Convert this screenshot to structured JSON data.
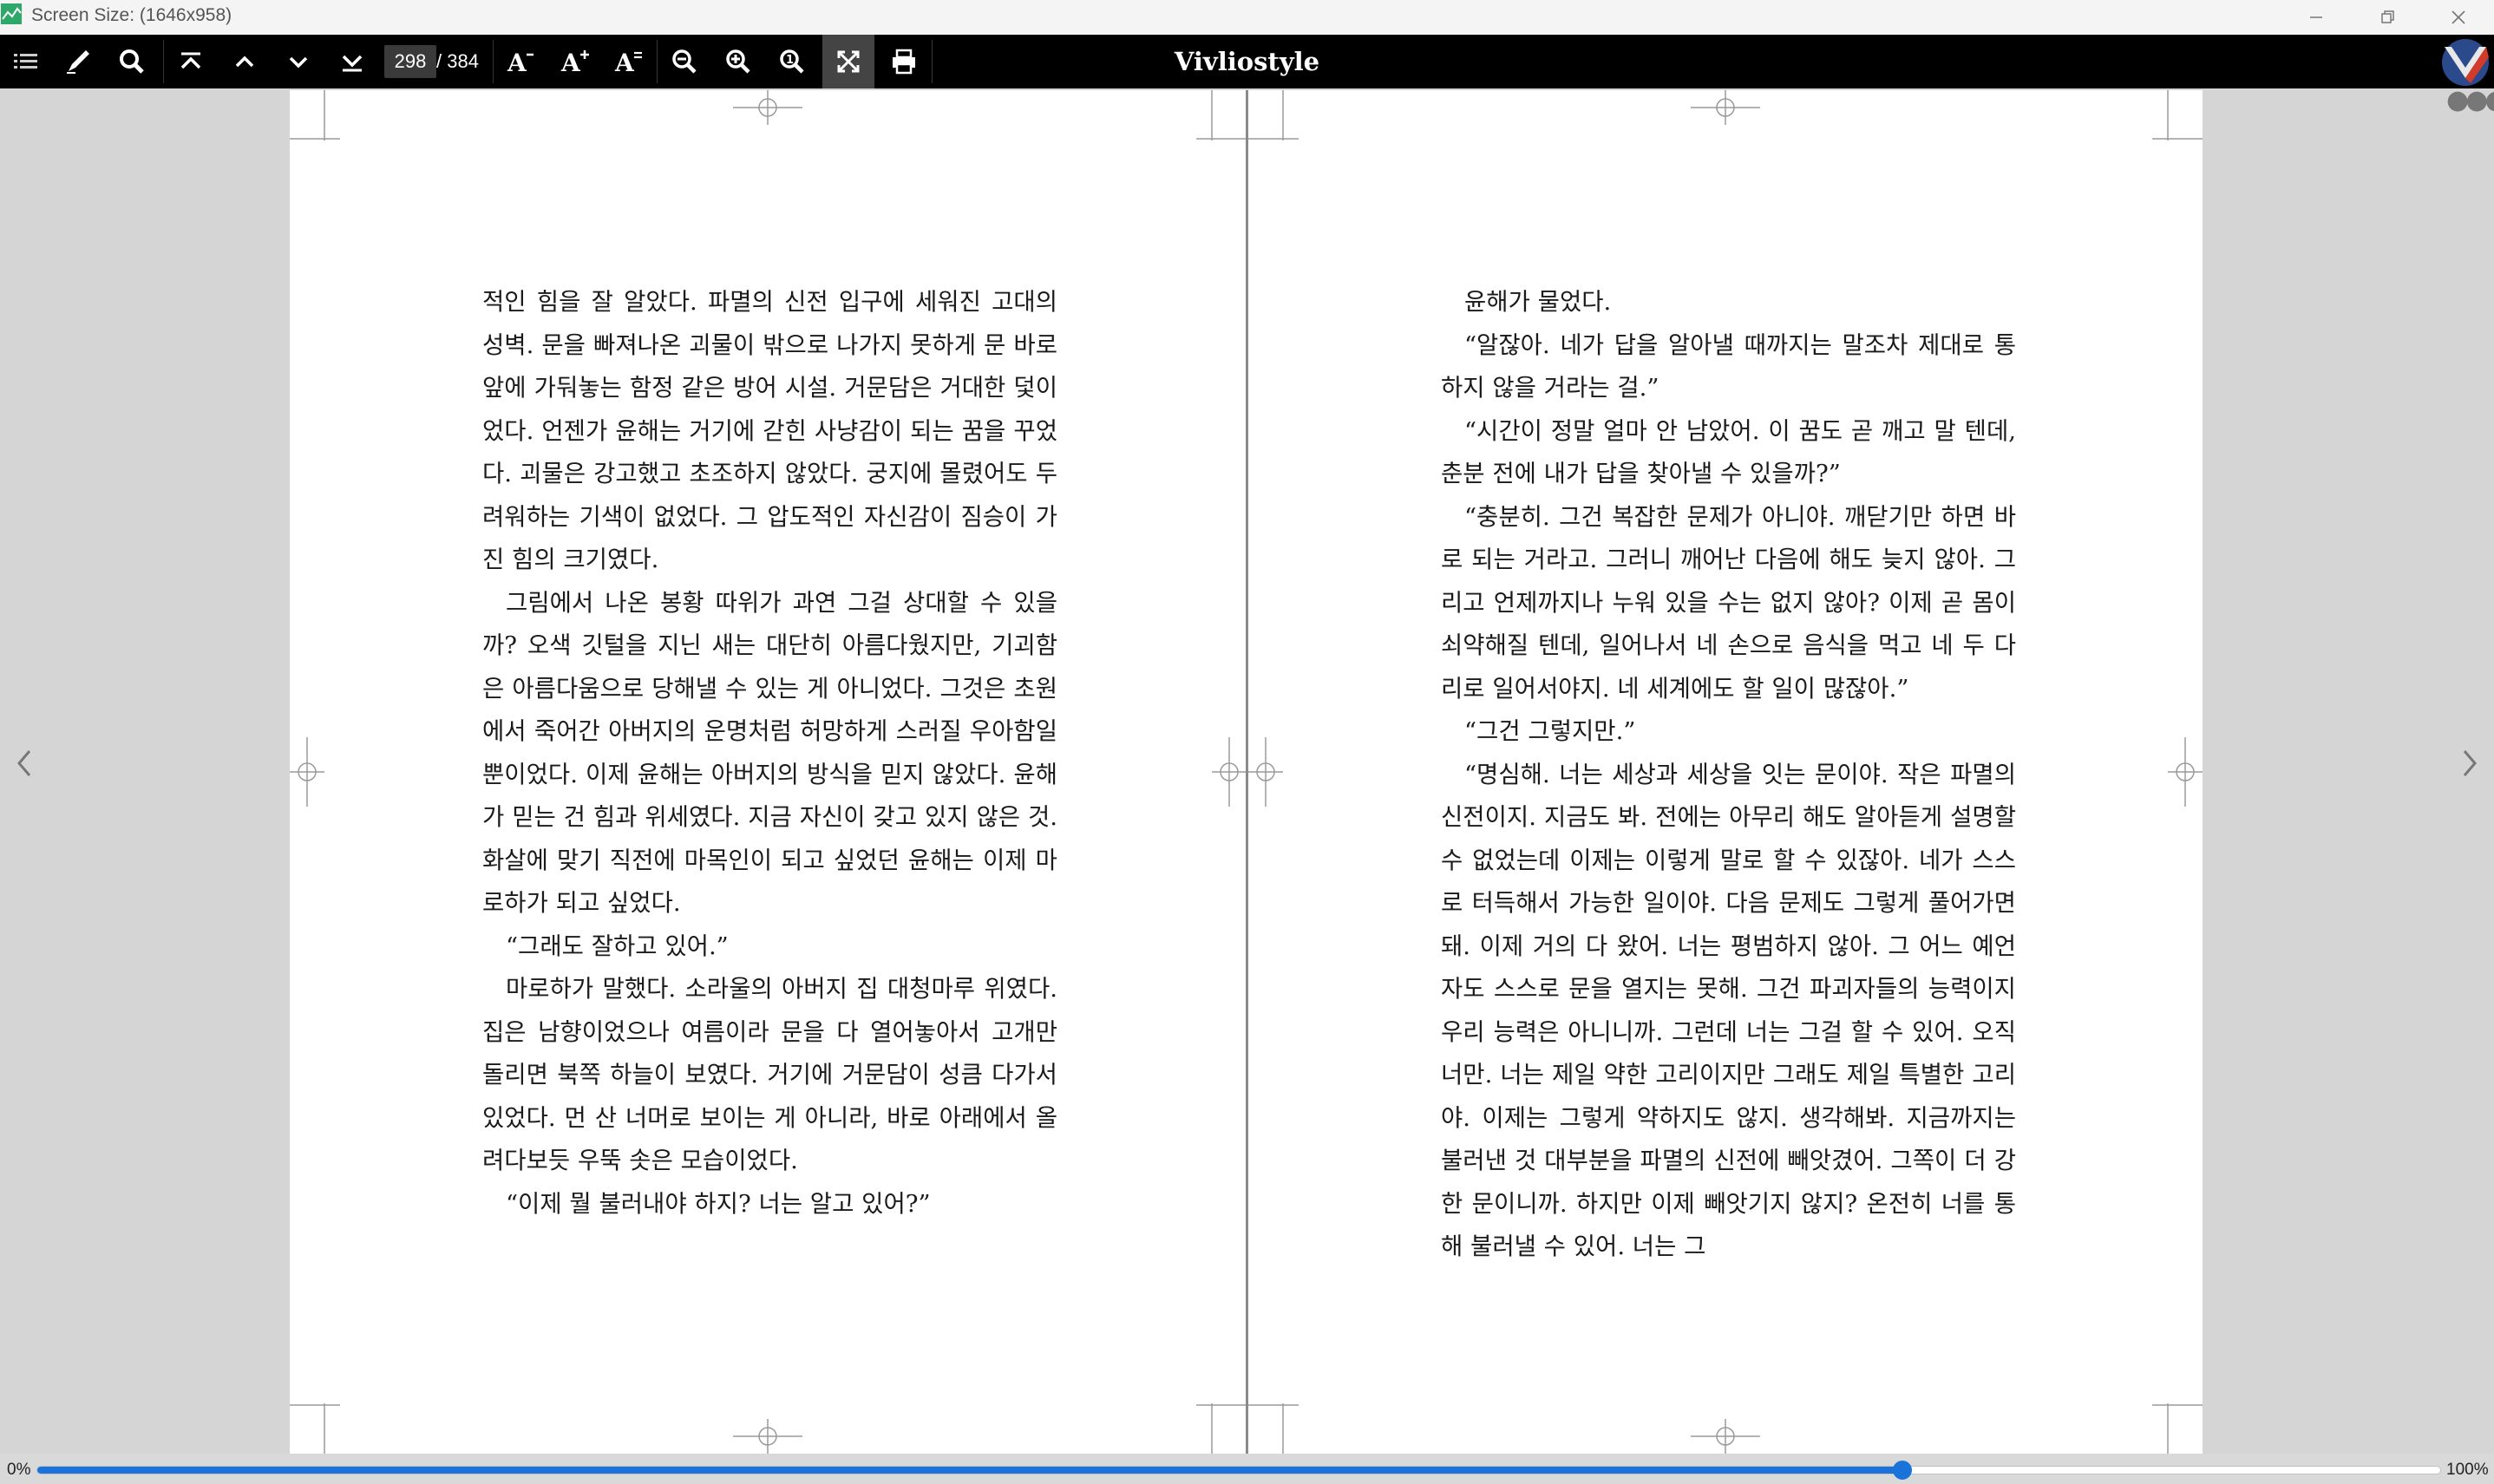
{
  "window": {
    "title": "Screen Size: (1646x958)",
    "minimize_icon": "minimize-icon",
    "maximize_icon": "maximize-icon",
    "close_icon": "close-icon"
  },
  "toolbar": {
    "brand": "Vivliostyle",
    "page_current": "298",
    "page_total": "/ 384",
    "icons": [
      "toc-icon",
      "marker-icon",
      "search-icon",
      "first-page-icon",
      "prev-page-icon",
      "next-page-icon",
      "last-page-icon",
      "font-decrease-icon",
      "font-increase-icon",
      "font-reset-icon",
      "zoom-out-icon",
      "zoom-in-icon",
      "zoom-actual-icon",
      "fit-page-icon",
      "print-icon"
    ]
  },
  "colors": {
    "toolbar_bg": "#000000",
    "viewer_bg": "#d5d5d5",
    "progress_accent": "#1a73d9"
  },
  "left_page": {
    "paragraphs": [
      {
        "text": "적인 힘을 잘 알았다. 파멸의 신전 입구에 세워진 고대의 성벽. 문을 빠져나온 괴물이 밖으로 나가지 못하게 문 바로 앞에 가둬놓는 함정 같은 방어 시설. 거문담은 거대한 덫이었다. 언젠가 윤해는 거기에 갇힌 사냥감이 되는 꿈을 꾸었다. 괴물은 강고했고 초조하지 않았다. 궁지에 몰렸어도 두려워하는 기색이 없었다. 그 압도적인 자신감이 짐승이 가진 힘의 크기였다.",
        "indent": false
      },
      {
        "text": "그림에서 나온 봉황 따위가 과연 그걸 상대할 수 있을까? 오색 깃털을 지닌 새는 대단히 아름다웠지만, 기괴함은 아름다움으로 당해낼 수 있는 게 아니었다. 그것은 초원에서 죽어간 아버지의 운명처럼 허망하게 스러질 우아함일 뿐이었다. 이제 윤해는 아버지의 방식을 믿지 않았다. 윤해가 믿는 건 힘과 위세였다. 지금 자신이 갖고 있지 않은 것. 화살에 맞기 직전에 마목인이 되고 싶었던 윤해는 이제 마로하가 되고 싶었다.",
        "indent": true
      },
      {
        "text": "“그래도 잘하고 있어.”",
        "indent": true
      },
      {
        "text": "마로하가 말했다. 소라울의 아버지 집 대청마루 위였다. 집은 남향이었으나 여름이라 문을 다 열어놓아서 고개만 돌리면 북쪽 하늘이 보였다. 거기에 거문담이 성큼 다가서 있었다. 먼 산 너머로 보이는 게 아니라, 바로 아래에서 올려다보듯 우뚝 솟은 모습이었다.",
        "indent": true
      },
      {
        "text": "“이제 뭘 불러내야 하지? 너는 알고 있어?”",
        "indent": true
      }
    ]
  },
  "right_page": {
    "paragraphs": [
      {
        "text": "윤해가 물었다.",
        "indent": true
      },
      {
        "text": "“알잖아. 네가 답을 알아낼 때까지는 말조차 제대로 통하지 않을 거라는 걸.”",
        "indent": true
      },
      {
        "text": "“시간이 정말 얼마 안 남았어. 이 꿈도 곧 깨고 말 텐데, 춘분 전에 내가 답을 찾아낼 수 있을까?”",
        "indent": true
      },
      {
        "text": "“충분히. 그건 복잡한 문제가 아니야. 깨닫기만 하면 바로 되는 거라고. 그러니 깨어난 다음에 해도 늦지 않아. 그리고 언제까지나 누워 있을 수는 없지 않아? 이제 곧 몸이 쇠약해질 텐데, 일어나서 네 손으로 음식을 먹고 네 두 다리로 일어서야지. 네 세계에도 할 일이 많잖아.”",
        "indent": true
      },
      {
        "text": "“그건 그렇지만.”",
        "indent": true
      },
      {
        "text": "“명심해. 너는 세상과 세상을 잇는 문이야. 작은 파멸의 신전이지. 지금도 봐. 전에는 아무리 해도 알아듣게 설명할 수 없었는데 이제는 이렇게 말로 할 수 있잖아. 네가 스스로 터득해서 가능한 일이야. 다음 문제도 그렇게 풀어가면 돼. 이제 거의 다 왔어. 너는 평범하지 않아. 그 어느 예언자도 스스로 문을 열지는 못해. 그건 파괴자들의 능력이지 우리 능력은 아니니까. 그런데 너는 그걸 할 수 있어. 오직 너만. 너는 제일 약한 고리이지만 그래도 제일 특별한 고리야. 이제는 그렇게 약하지도 않지. 생각해봐. 지금까지는 불러낸 것 대부분을 파멸의 신전에 빼앗겼어. 그쪽이 더 강한 문이니까. 하지만 이제 빼앗기지 않지? 온전히 너를 통해 불러낼 수 있어. 너는 그",
        "indent": true
      }
    ]
  },
  "navigation": {
    "prev_icon": "chevron-left-icon",
    "next_icon": "chevron-right-icon"
  },
  "progress": {
    "min_label": "0%",
    "max_label": "100%",
    "value": 0.776
  }
}
